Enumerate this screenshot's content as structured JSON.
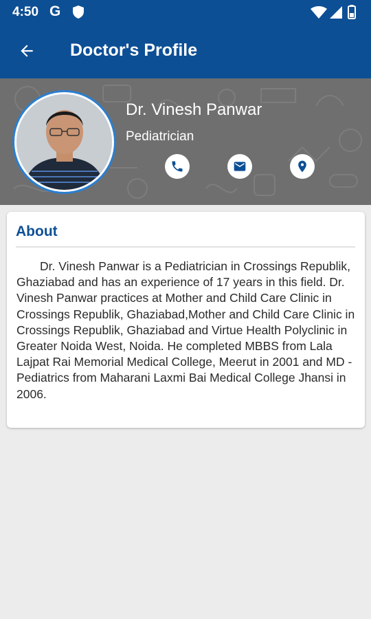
{
  "status_bar": {
    "time": "4:50",
    "g_icon": "google-g-icon",
    "icons": [
      "shield-icon",
      "wifi-icon",
      "signal-icon",
      "battery-icon"
    ]
  },
  "app_bar": {
    "back_icon": "arrow-back-icon",
    "title": "Doctor's Profile",
    "color": "#0d4f95"
  },
  "profile": {
    "name": "Dr. Vinesh Panwar",
    "specialty": "Pediatrician",
    "actions": [
      {
        "icon": "phone-icon"
      },
      {
        "icon": "mail-icon"
      },
      {
        "icon": "location-pin-icon"
      }
    ]
  },
  "about": {
    "heading": "About",
    "text": "Dr. Vinesh Panwar is a Pediatrician in Crossings Republik, Ghaziabad and has an experience of 17 years in this field. Dr. Vinesh Panwar practices at Mother and Child Care Clinic in Crossings Republik, Ghaziabad,Mother and Child Care Clinic in Crossings Republik, Ghaziabad and Virtue Health Polyclinic in Greater Noida West, Noida. He completed MBBS from Lala Lajpat Rai Memorial Medical College, Meerut in 2001 and MD - Pediatrics from Maharani Laxmi Bai Medical College Jhansi in 2006."
  },
  "colors": {
    "primary": "#0d4f95",
    "banner": "#6f6f6f",
    "page_bg": "#ececec"
  }
}
